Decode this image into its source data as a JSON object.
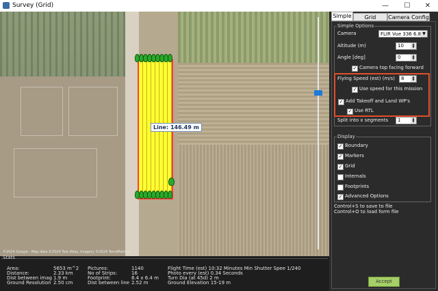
{
  "window": {
    "title": "Survey (Grid)",
    "minimize": "—",
    "maximize": "☐",
    "close": "✕"
  },
  "map": {
    "line_label": "Line: 146.49 m",
    "copyright": "©2024 Google - Map data ©2024 Tele Atlas, Imagery ©2024 TerraMetrics"
  },
  "stats": {
    "legend": "Stats",
    "col1": [
      {
        "label": "Area:",
        "value": "5653 m^2"
      },
      {
        "label": "Distance:",
        "value": "2.33 km"
      },
      {
        "label": "Dist between imag",
        "value": "1.9 m"
      },
      {
        "label": "Ground Resolution",
        "value": "2.50 cm"
      }
    ],
    "col2": [
      {
        "label": "Pictures:",
        "value": "1140"
      },
      {
        "label": "No of Strips:",
        "value": "16"
      },
      {
        "label": "Footprint:",
        "value": "8.4 x 6.4 m"
      },
      {
        "label": "Dist between line",
        "value": "2.52 m"
      }
    ],
    "col3": [
      "Flight Time (est) 10:32 Minutes Min Shutter Spee 1/240",
      "Photo every (est) 0.34 Seconds",
      "Turn Dia (at 45d) 2 m",
      "Ground Elevation 15-19 m"
    ]
  },
  "tabs": [
    {
      "label": "Simple"
    },
    {
      "label": "Grid Options"
    },
    {
      "label": "Camera Config"
    }
  ],
  "simple": {
    "group_title": "Simple Options",
    "camera_label": "Camera",
    "camera_value": "FLIR Vue 336 6.8",
    "altitude_label": "Altitude (m)",
    "altitude_value": "10",
    "angle_label": "Angle [deg]",
    "angle_value": "0",
    "camera_top_label": "Camera top facing forward",
    "flying_speed_label": "Flying Speed (est) (m/s)",
    "flying_speed_value": "8",
    "use_speed_label": "Use speed for this mission",
    "takeoff_label": "Add Takeoff and Land WP's",
    "use_rtl_label": "Use RTL",
    "split_label": "Split into x segments",
    "split_value": "1"
  },
  "display": {
    "group_title": "Display",
    "options": [
      {
        "label": "Boundary",
        "checked": "✓"
      },
      {
        "label": "Markers",
        "checked": "✓"
      },
      {
        "label": "Grid",
        "checked": "✓"
      },
      {
        "label": "Internals",
        "checked": ""
      },
      {
        "label": "Footprints",
        "checked": ""
      },
      {
        "label": "Advanced Options",
        "checked": "✓"
      }
    ]
  },
  "shortcuts": [
    "Control+S to save to file",
    "Control+O to load form file"
  ],
  "accept_label": "Accept",
  "colors": {
    "survey_fill": "#ffff33",
    "survey_border": "#ff3b3b",
    "highlight": "#e0502a",
    "accept": "#a6cf67",
    "marker": "#2ca82c"
  }
}
